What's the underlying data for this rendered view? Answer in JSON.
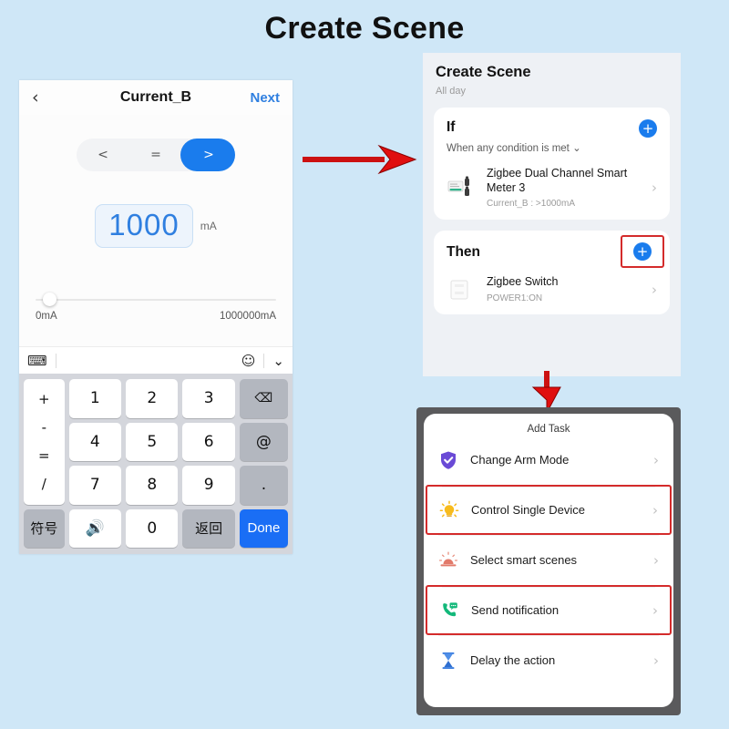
{
  "page": {
    "title": "Create Scene"
  },
  "colors": {
    "background": "#cfe7f7",
    "accent_blue": "#1a7ced",
    "highlight_red": "#d42b2b",
    "key_blue": "#1a6ef5",
    "shield_purple": "#6a4ad6",
    "bulb_yellow": "#f5b820",
    "scene_salmon": "#e27a6a",
    "phone_green": "#13b87a",
    "hourglass_blue": "#3b7ee0"
  },
  "panel1": {
    "back_icon": "chevron-left-icon",
    "title": "Current_B",
    "next_label": "Next",
    "operators": [
      {
        "label": "<",
        "active": false
      },
      {
        "label": "=",
        "active": false
      },
      {
        "label": ">",
        "active": true
      }
    ],
    "value": "1000",
    "unit": "mA",
    "slider": {
      "min_label": "0mA",
      "max_label": "1000000mA",
      "min": 0,
      "max": 1000000,
      "value": 1000,
      "thumb_percent": 3
    },
    "keyboard_toolbar": {
      "left_icon": "globe-keyboard-icon",
      "emoji_icon": "emoji-smiley-icon",
      "collapse_icon": "chevron-down-icon"
    },
    "keypad": {
      "operators": [
        "+",
        "-",
        "=",
        "/"
      ],
      "digits_row1": [
        "1",
        "2",
        "3"
      ],
      "digits_row2": [
        "4",
        "5",
        "6"
      ],
      "digits_row3": [
        "7",
        "8",
        "9"
      ],
      "backspace": "backspace-icon",
      "at_key": "@",
      "dot_key": ".",
      "symbols_key": "符号",
      "mic_key": "mic-icon",
      "zero_key": "0",
      "return_key": "返回",
      "done_key": "Done"
    }
  },
  "panel2": {
    "title": "Create Scene",
    "subtitle": "All day",
    "if_section": {
      "label": "If",
      "description": "When any condition is met",
      "add_icon": "plus-circle-icon",
      "device": {
        "icon": "zigbee-meter-icon",
        "name": "Zigbee Dual Channel Smart Meter 3",
        "detail": "Current_B : >1000mA",
        "chevron": "chevron-right-icon"
      }
    },
    "then_section": {
      "label": "Then",
      "add_icon": "plus-circle-icon",
      "highlighted": true,
      "device": {
        "icon": "zigbee-switch-icon",
        "name": "Zigbee Switch",
        "detail": "POWER1:ON",
        "chevron": "chevron-right-icon"
      }
    }
  },
  "panel3": {
    "title": "Add Task",
    "tasks": [
      {
        "icon": "shield-check-icon",
        "label": "Change Arm Mode",
        "highlighted": false
      },
      {
        "icon": "light-bulb-icon",
        "label": "Control Single Device",
        "highlighted": true
      },
      {
        "icon": "smart-scene-icon",
        "label": "Select smart scenes",
        "highlighted": false
      },
      {
        "icon": "phone-message-icon",
        "label": "Send notification",
        "highlighted": true
      },
      {
        "icon": "hourglass-icon",
        "label": "Delay the action",
        "highlighted": false
      }
    ],
    "chevron": "chevron-right-icon"
  },
  "arrows": [
    {
      "name": "arrow-panel1-to-panel2",
      "direction": "right"
    },
    {
      "name": "arrow-panel2-to-panel3",
      "direction": "down"
    }
  ]
}
